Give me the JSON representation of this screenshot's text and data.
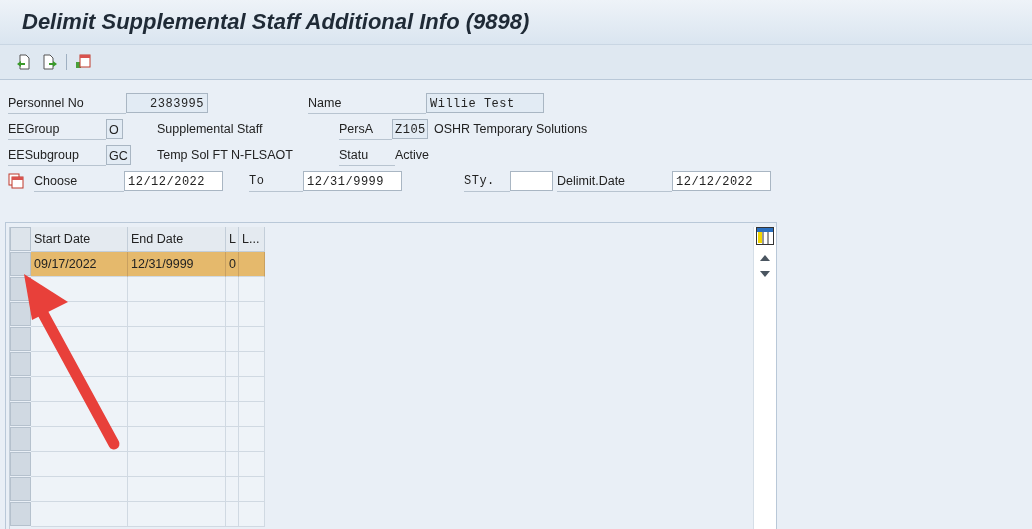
{
  "window": {
    "title": "Delimit Supplemental Staff Additional Info (9898)"
  },
  "toolbar": {
    "buttons": [
      {
        "kind": "prev"
      },
      {
        "kind": "next"
      },
      {
        "kind": "calendar"
      }
    ]
  },
  "header": {
    "personnel_no": {
      "label": "Personnel No",
      "value": "2383995"
    },
    "name": {
      "label": "Name",
      "value": "Willie Test"
    },
    "ee_group": {
      "label": "EEGroup",
      "value": "O",
      "text": "Supplemental Staff"
    },
    "pers_area": {
      "label": "PersA",
      "value": "Z105",
      "text": "OSHR Temporary Solutions"
    },
    "ee_subgroup": {
      "label": "EESubgroup",
      "value": "GC",
      "text": "Temp Sol FT N-FLSAOT"
    },
    "status": {
      "label": "Statu",
      "text": "Active"
    },
    "choose": {
      "label": "Choose",
      "value": "12/12/2022"
    },
    "to": {
      "label": "To",
      "value": "12/31/9999"
    },
    "sty": {
      "label": "STy."
    },
    "delimit_date": {
      "label": "Delimit.Date",
      "value": "12/12/2022"
    }
  },
  "table": {
    "columns": [
      "Start Date",
      "End Date",
      "L",
      "L..."
    ],
    "rows": [
      {
        "cells": [
          "09/17/2022",
          "12/31/9999",
          "0",
          ""
        ],
        "selected": true
      }
    ]
  },
  "annotation": {
    "kind": "arrow"
  }
}
